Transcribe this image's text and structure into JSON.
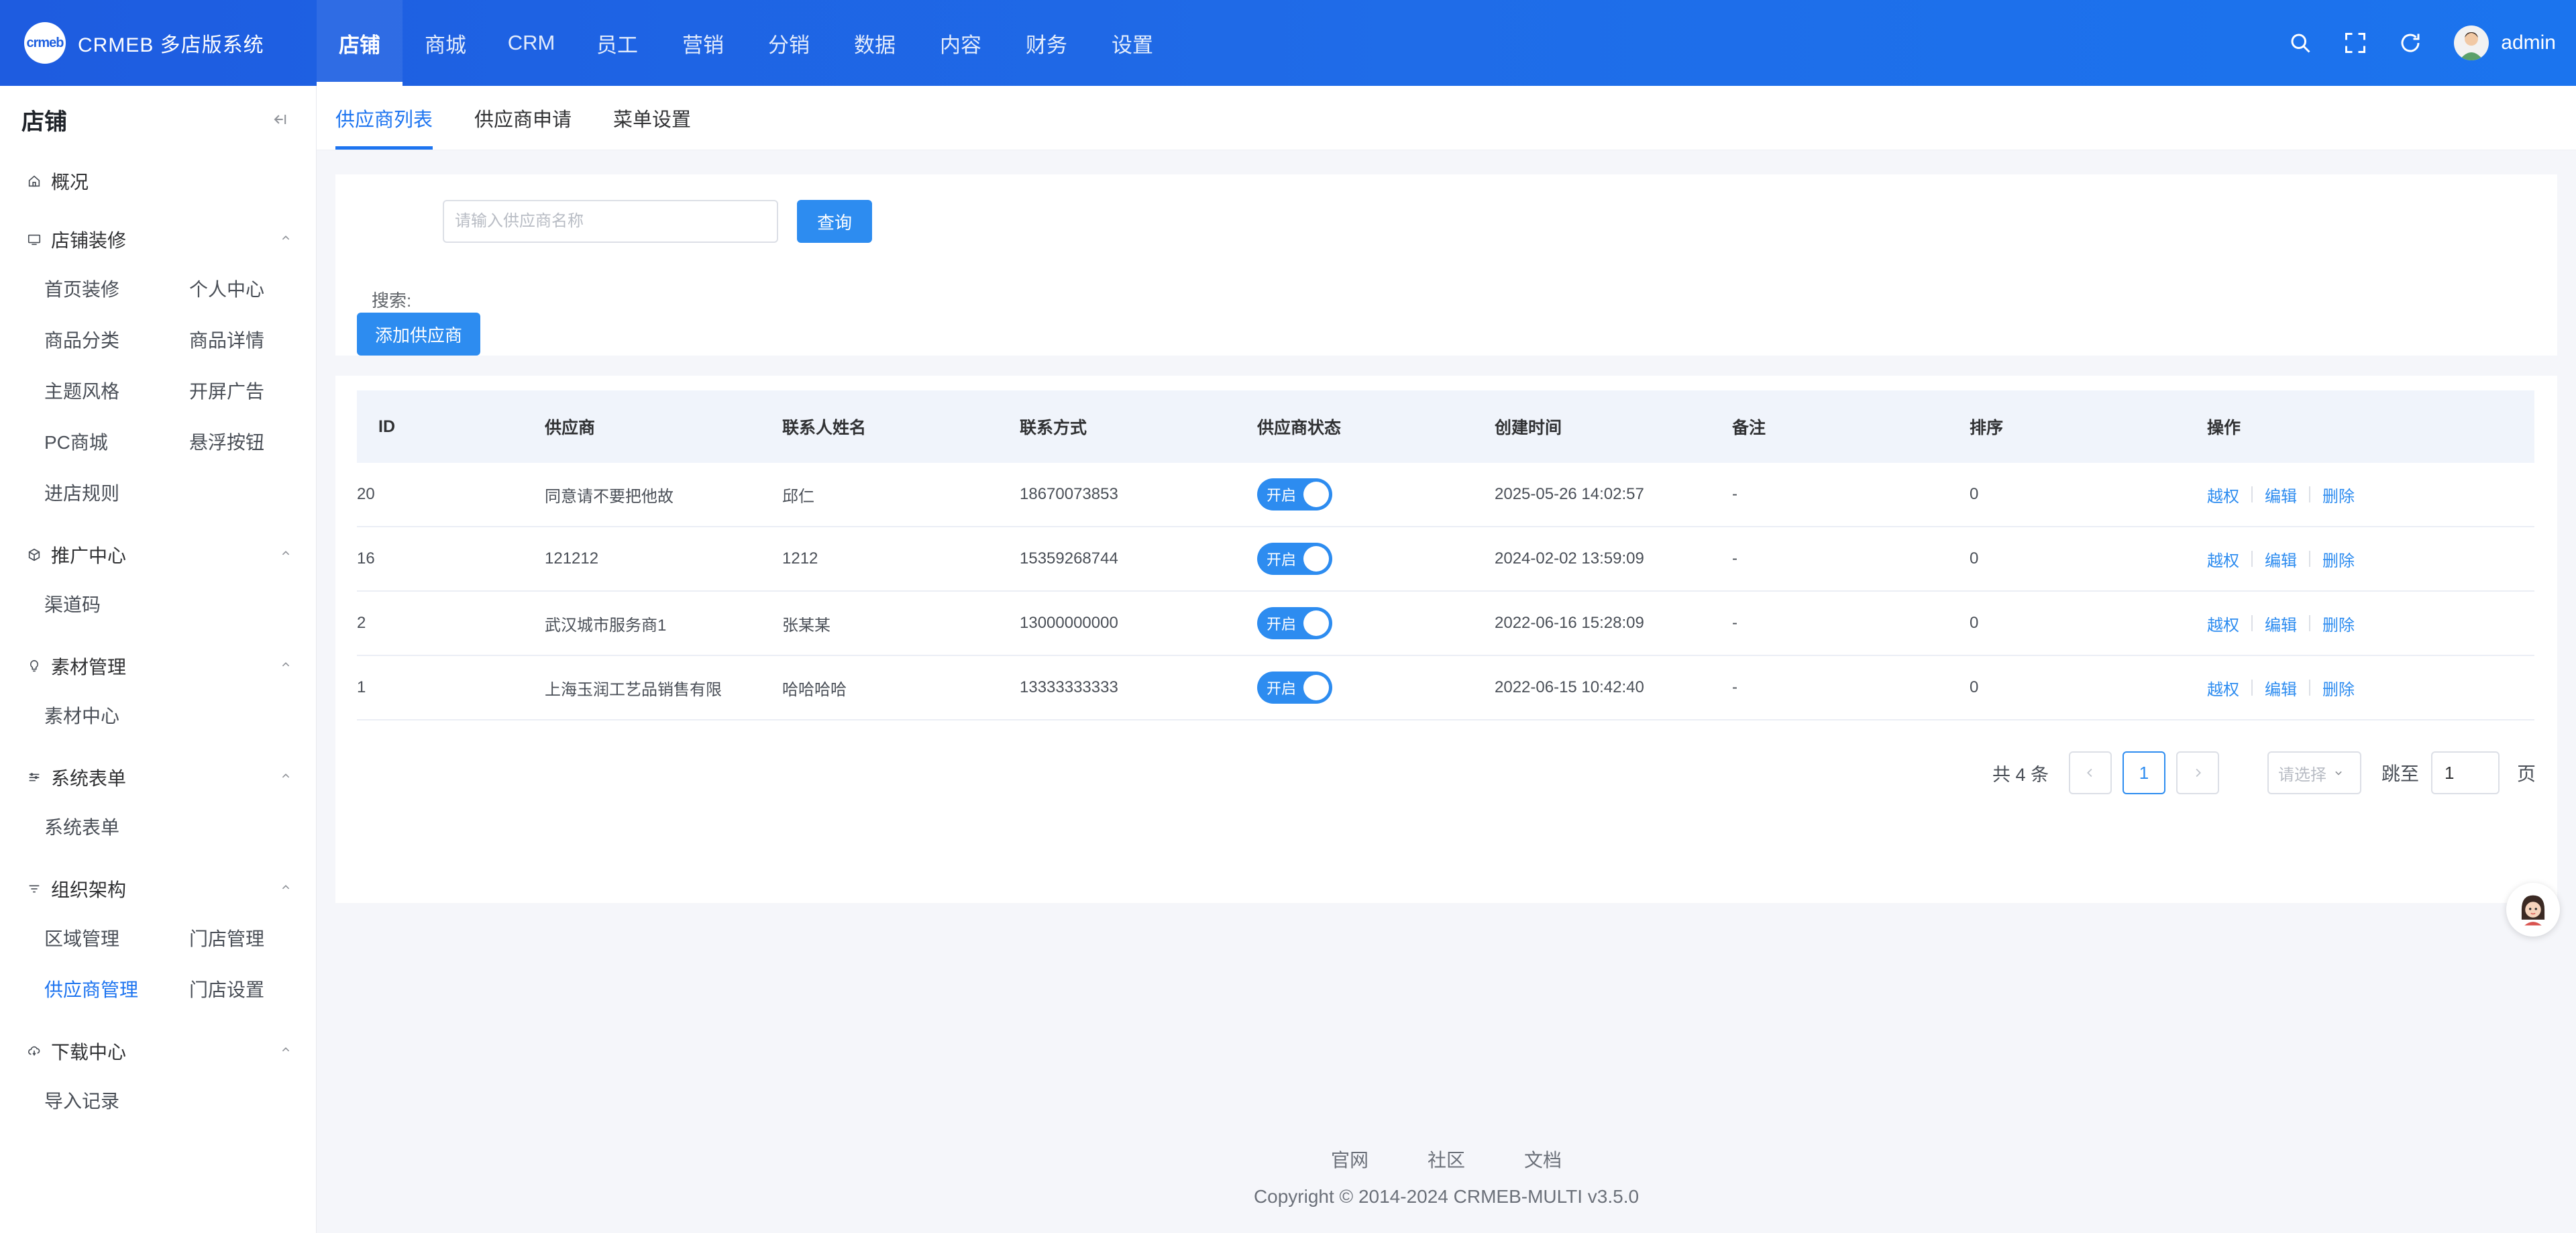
{
  "header": {
    "brand_title": "CRMEB 多店版系统",
    "logo_text": "crmeb",
    "nav": [
      {
        "label": "店铺",
        "active": true
      },
      {
        "label": "商城"
      },
      {
        "label": "CRM"
      },
      {
        "label": "员工"
      },
      {
        "label": "营销"
      },
      {
        "label": "分销"
      },
      {
        "label": "数据"
      },
      {
        "label": "内容"
      },
      {
        "label": "财务"
      },
      {
        "label": "设置"
      }
    ],
    "icons": [
      "search-icon",
      "fullscreen-icon",
      "refresh-icon"
    ],
    "user_name": "admin"
  },
  "sidebar": {
    "title": "店铺",
    "overview": "概况",
    "groups": [
      {
        "title": "店铺装修",
        "icon": "monitor-icon",
        "items": [
          "首页装修",
          "个人中心",
          "商品分类",
          "商品详情",
          "主题风格",
          "开屏广告",
          "PC商城",
          "悬浮按钮",
          "进店规则"
        ]
      },
      {
        "title": "推广中心",
        "icon": "cube-icon",
        "items": [
          "渠道码"
        ]
      },
      {
        "title": "素材管理",
        "icon": "bulb-icon",
        "items": [
          "素材中心"
        ]
      },
      {
        "title": "系统表单",
        "icon": "form-icon",
        "items": [
          "系统表单"
        ]
      },
      {
        "title": "组织架构",
        "icon": "filter-icon",
        "items": [
          "区域管理",
          "门店管理",
          "供应商管理",
          "门店设置"
        ],
        "active_item": "供应商管理"
      },
      {
        "title": "下载中心",
        "icon": "cloud-icon",
        "items": [
          "导入记录"
        ]
      }
    ]
  },
  "tabs": [
    {
      "label": "供应商列表",
      "active": true
    },
    {
      "label": "供应商申请"
    },
    {
      "label": "菜单设置"
    }
  ],
  "search": {
    "label": "搜索:",
    "placeholder": "请输入供应商名称",
    "button": "查询"
  },
  "add_button": "添加供应商",
  "table": {
    "columns": [
      "ID",
      "供应商",
      "联系人姓名",
      "联系方式",
      "供应商状态",
      "创建时间",
      "备注",
      "排序",
      "操作"
    ],
    "rows": [
      {
        "id": "20",
        "supplier": "同意请不要把他故",
        "contact": "邱仁",
        "phone": "18670073853",
        "status": "开启",
        "created": "2025-05-26 14:02:57",
        "note": "-",
        "sort": "0"
      },
      {
        "id": "16",
        "supplier": "121212",
        "contact": "1212",
        "phone": "15359268744",
        "status": "开启",
        "created": "2024-02-02 13:59:09",
        "note": "-",
        "sort": "0"
      },
      {
        "id": "2",
        "supplier": "武汉城市服务商1",
        "contact": "张某某",
        "phone": "13000000000",
        "status": "开启",
        "created": "2022-06-16 15:28:09",
        "note": "-",
        "sort": "0"
      },
      {
        "id": "1",
        "supplier": "上海玉润工艺品销售有限",
        "contact": "哈哈哈哈",
        "phone": "13333333333",
        "status": "开启",
        "created": "2022-06-15 10:42:40",
        "note": "-",
        "sort": "0"
      }
    ],
    "actions": [
      "越权",
      "编辑",
      "删除"
    ]
  },
  "pagination": {
    "total": "共 4 条",
    "current_page": "1",
    "page_size_placeholder": "请选择",
    "goto_label": "跳至",
    "goto_value": "1",
    "page_unit": "页"
  },
  "footer": {
    "links": [
      "官网",
      "社区",
      "文档"
    ],
    "copyright": "Copyright © 2014-2024 CRMEB-MULTI v3.5.0"
  },
  "colors": {
    "primary": "#2d8cf0",
    "header_bg": "#1f6ce8",
    "active_text": "#1d74f0"
  }
}
